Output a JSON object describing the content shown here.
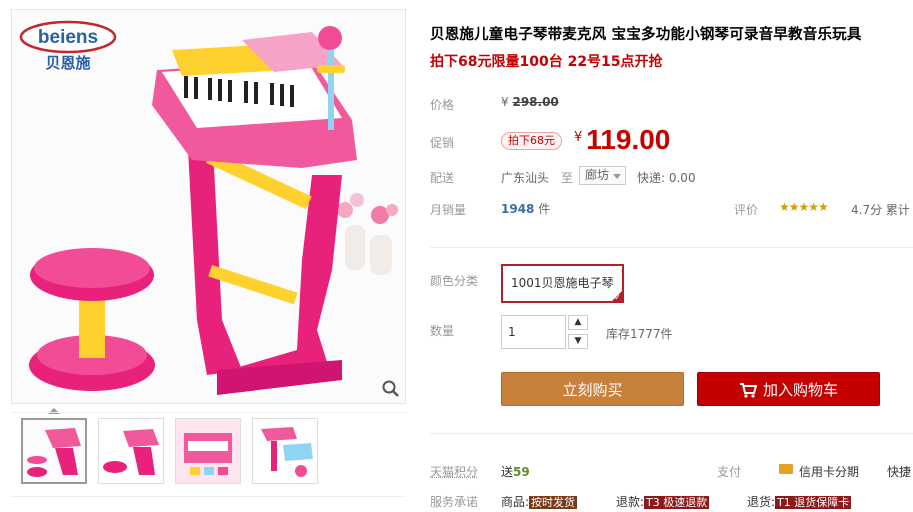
{
  "brand": {
    "logo_text": "beiens",
    "logo_cn": "贝恩施"
  },
  "product": {
    "title": "贝恩施儿童电子琴带麦克风 宝宝多功能小钢琴可录音早教音乐玩具",
    "subtitle": "拍下68元限量100台 22号15点开抢"
  },
  "price": {
    "label": "价格",
    "currency": "¥",
    "original": "298.00"
  },
  "promo": {
    "label": "促销",
    "tag": "拍下68元",
    "currency": "¥",
    "price": "119.00"
  },
  "delivery": {
    "label": "配送",
    "from": "广东汕头",
    "to_word": "至",
    "city": "廊坊",
    "express": "快递: 0.00"
  },
  "sales": {
    "label": "月销量",
    "count": "1948",
    "unit": "件",
    "rating_label": "评价",
    "stars": "★★★★★",
    "score": "4.7分",
    "more": "累计"
  },
  "sku": {
    "label": "颜色分类",
    "selected": "1001贝恩施电子琴",
    "check": "✓"
  },
  "quantity": {
    "label": "数量",
    "value": "1",
    "up": "▲",
    "down": "▼",
    "stock": "库存1777件"
  },
  "actions": {
    "buy_now": "立刻购买",
    "add_cart": "加入购物车"
  },
  "points": {
    "label": "天猫积分",
    "prefix": "送",
    "value": "59"
  },
  "payment": {
    "label": "支付",
    "card": "信用卡分期",
    "more": "快捷"
  },
  "service": {
    "label": "服务承诺",
    "items": [
      {
        "name": "商品:",
        "tag": "按时发货"
      },
      {
        "name": "退款:",
        "tag": "T3 极速退款"
      },
      {
        "name": "退货:",
        "tag": "T1 退货保障卡"
      }
    ]
  },
  "colors": {
    "accent": "#c40000",
    "buy": "#c8813d",
    "pink": "#e8217a"
  }
}
